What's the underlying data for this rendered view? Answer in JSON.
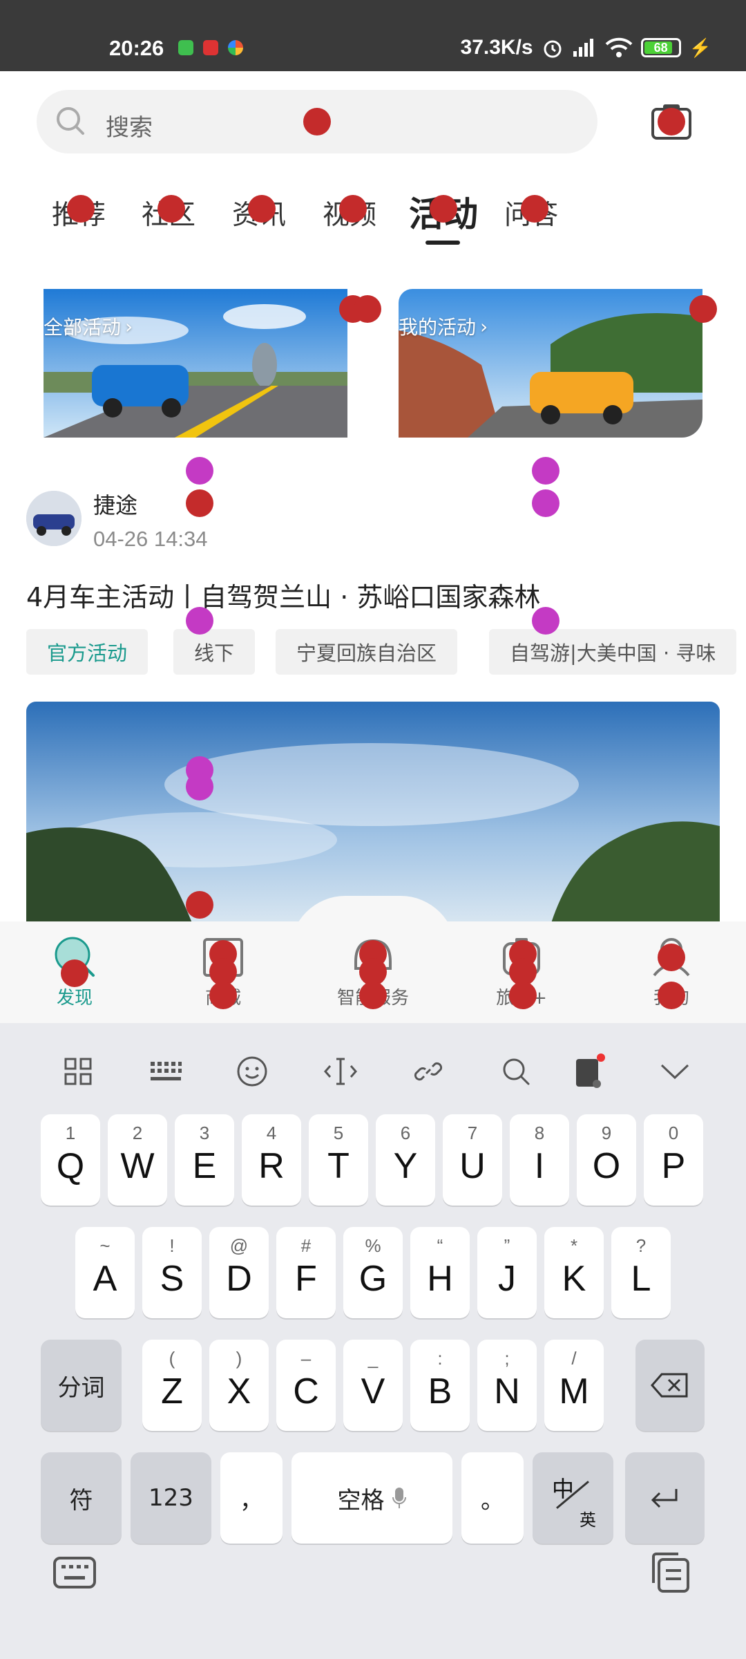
{
  "status_bar": {
    "time": "20:26",
    "network_speed": "37.3K/s",
    "battery": "68"
  },
  "search": {
    "placeholder": "搜索"
  },
  "tabs": [
    "推荐",
    "社区",
    "资讯",
    "视频",
    "活动",
    "问答"
  ],
  "active_tab": "活动",
  "banners": {
    "all_activities": "全部活动",
    "my_activities": "我的活动"
  },
  "post": {
    "author": "捷途",
    "date": "04-26 14:34",
    "title": "4月车主活动丨自驾贺兰山 · 苏峪口国家森林",
    "tags": [
      "官方活动",
      "线下",
      "宁夏回族自治区",
      "自驾游|大美中国 · 寻味"
    ]
  },
  "bottom_nav": {
    "items": [
      "发现",
      "商城",
      "智能服务",
      "旅行+",
      "我的"
    ],
    "active": "发现"
  },
  "keyboard": {
    "row1": [
      {
        "main": "Q",
        "sub": "1"
      },
      {
        "main": "W",
        "sub": "2"
      },
      {
        "main": "E",
        "sub": "3"
      },
      {
        "main": "R",
        "sub": "4"
      },
      {
        "main": "T",
        "sub": "5"
      },
      {
        "main": "Y",
        "sub": "6"
      },
      {
        "main": "U",
        "sub": "7"
      },
      {
        "main": "I",
        "sub": "8"
      },
      {
        "main": "O",
        "sub": "9"
      },
      {
        "main": "P",
        "sub": "0"
      }
    ],
    "row2": [
      {
        "main": "A",
        "sub": "~"
      },
      {
        "main": "S",
        "sub": "!"
      },
      {
        "main": "D",
        "sub": "@"
      },
      {
        "main": "F",
        "sub": "#"
      },
      {
        "main": "G",
        "sub": "%"
      },
      {
        "main": "H",
        "sub": "“"
      },
      {
        "main": "J",
        "sub": "”"
      },
      {
        "main": "K",
        "sub": "*"
      },
      {
        "main": "L",
        "sub": "?"
      }
    ],
    "row3": [
      {
        "main": "Z",
        "sub": "("
      },
      {
        "main": "X",
        "sub": ")"
      },
      {
        "main": "C",
        "sub": "–"
      },
      {
        "main": "V",
        "sub": "_"
      },
      {
        "main": "B",
        "sub": ":"
      },
      {
        "main": "N",
        "sub": ";"
      },
      {
        "main": "M",
        "sub": "/"
      }
    ],
    "segment_key": "分词",
    "symbol_key": "符",
    "number_key": "123",
    "comma_key": "，",
    "space_key": "空格",
    "period_key": "。",
    "lang_key_cn": "中",
    "lang_key_en": "英"
  },
  "colors": {
    "accent": "#1a9a8d",
    "marker_red": "#c42b2b",
    "marker_magenta": "#c43ac4"
  }
}
